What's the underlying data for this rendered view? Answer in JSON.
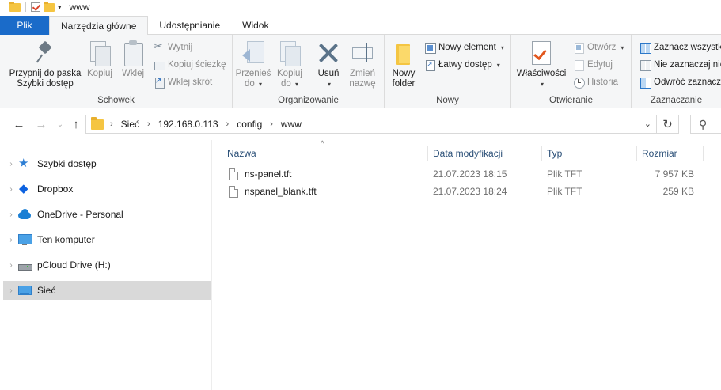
{
  "window": {
    "title": "www"
  },
  "ribbon_tabs": [
    "Plik",
    "Narzędzia główne",
    "Udostępnianie",
    "Widok"
  ],
  "ribbon": {
    "clipboard": {
      "label": "Schowek",
      "pin_line1": "Przypnij do paska",
      "pin_line2": "Szybki dostęp",
      "copy": "Kopiuj",
      "paste": "Wklej",
      "cut": "Wytnij",
      "copy_path": "Kopiuj ścieżkę",
      "paste_shortcut": "Wklej skrót"
    },
    "organize": {
      "label": "Organizowanie",
      "move_to_line1": "Przenieś",
      "move_to_line2": "do",
      "copy_to_line1": "Kopiuj",
      "copy_to_line2": "do",
      "delete": "Usuń",
      "rename_line1": "Zmień",
      "rename_line2": "nazwę"
    },
    "new": {
      "label": "Nowy",
      "new_folder_line1": "Nowy",
      "new_folder_line2": "folder",
      "new_item": "Nowy element",
      "easy_access": "Łatwy dostęp"
    },
    "open": {
      "label": "Otwieranie",
      "properties": "Właściwości",
      "open": "Otwórz",
      "edit": "Edytuj",
      "history": "Historia"
    },
    "select": {
      "label": "Zaznaczanie",
      "select_all": "Zaznacz wszystko",
      "select_none": "Nie zaznaczaj nic",
      "invert": "Odwróć zaznaczenie"
    }
  },
  "address": {
    "crumbs": [
      "Sieć",
      "192.168.0.113",
      "config",
      "www"
    ]
  },
  "nav_pane": {
    "items": [
      {
        "label": "Szybki dostęp"
      },
      {
        "label": "Dropbox"
      },
      {
        "label": "OneDrive - Personal"
      },
      {
        "label": "Ten komputer"
      },
      {
        "label": "pCloud Drive (H:)"
      },
      {
        "label": "Sieć",
        "selected": true
      }
    ]
  },
  "columns": {
    "name": "Nazwa",
    "date": "Data modyfikacji",
    "type": "Typ",
    "size": "Rozmiar"
  },
  "files": [
    {
      "name": "ns-panel.tft",
      "date": "21.07.2023 18:15",
      "type": "Plik TFT",
      "size": "7 957 KB"
    },
    {
      "name": "nspanel_blank.tft",
      "date": "21.07.2023 18:24",
      "type": "Plik TFT",
      "size": "259 KB"
    }
  ],
  "colors": {
    "file_tab": "#1a6bc9",
    "selected_nav": "#d9d9d9",
    "column_header_text": "#2a4f77"
  }
}
